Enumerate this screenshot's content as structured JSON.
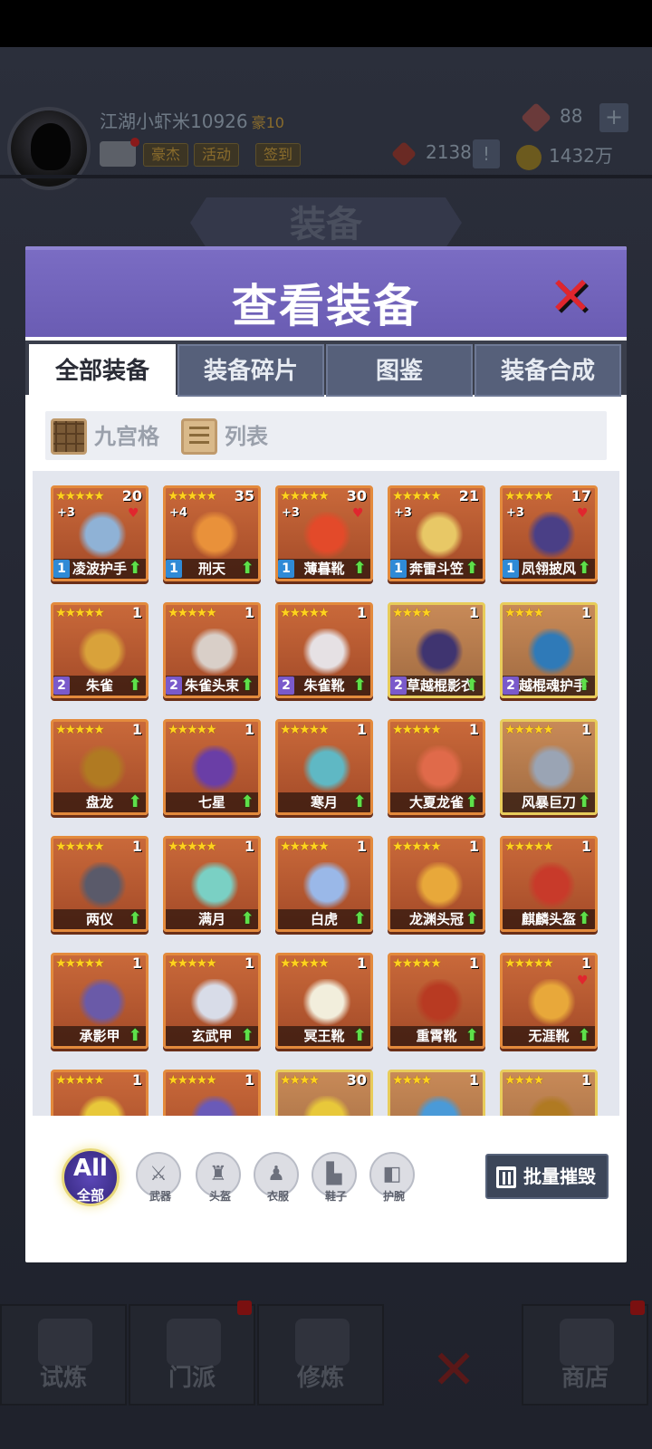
{
  "header": {
    "player_name": "江湖小虾米10926",
    "rank_badge": "豪10",
    "tags": [
      "豪杰",
      "活动",
      "签到"
    ],
    "gems": "88",
    "tokens": "2138",
    "coins": "1432万",
    "plus": "+",
    "excl": "!"
  },
  "background_title": "装备",
  "modal": {
    "title": "查看装备",
    "close": "✕",
    "tabs": [
      "全部装备",
      "装备碎片",
      "图鉴",
      "装备合成"
    ],
    "view_modes": [
      "九宫格",
      "列表"
    ],
    "items": [
      {
        "stars": "★★★★★",
        "count": "20",
        "level": "+3",
        "fav": true,
        "name": "凌波护手",
        "grade": "1",
        "grade_color": "#2f8ad6",
        "tier": 5,
        "art_color": "#8fb2d6"
      },
      {
        "stars": "★★★★★",
        "count": "35",
        "level": "+4",
        "fav": false,
        "name": "刑天",
        "grade": "1",
        "grade_color": "#2f8ad6",
        "tier": 5,
        "art_color": "#e9913a"
      },
      {
        "stars": "★★★★★",
        "count": "30",
        "level": "+3",
        "fav": true,
        "name": "薄暮靴",
        "grade": "1",
        "grade_color": "#2f8ad6",
        "tier": 5,
        "art_color": "#e34a2a"
      },
      {
        "stars": "★★★★★",
        "count": "21",
        "level": "+3",
        "fav": false,
        "name": "奔雷斗笠",
        "grade": "1",
        "grade_color": "#2f8ad6",
        "tier": 5,
        "art_color": "#e8c866"
      },
      {
        "stars": "★★★★★",
        "count": "17",
        "level": "+3",
        "fav": true,
        "name": "凤翎披风",
        "grade": "1",
        "grade_color": "#2f8ad6",
        "tier": 5,
        "art_color": "#4a3f86"
      },
      {
        "stars": "★★★★★",
        "count": "1",
        "level": "",
        "fav": false,
        "name": "朱雀",
        "grade": "2",
        "grade_color": "#7a5acb",
        "tier": 5,
        "art_color": "#d9a23a"
      },
      {
        "stars": "★★★★★",
        "count": "1",
        "level": "",
        "fav": false,
        "name": "朱雀头束",
        "grade": "2",
        "grade_color": "#7a5acb",
        "tier": 5,
        "art_color": "#d9cfc8"
      },
      {
        "stars": "★★★★★",
        "count": "1",
        "level": "",
        "fav": false,
        "name": "朱雀靴",
        "grade": "2",
        "grade_color": "#7a5acb",
        "tier": 5,
        "art_color": "#e6e1e4"
      },
      {
        "stars": "★★★★",
        "count": "1",
        "level": "",
        "fav": false,
        "name": "草越棍影衣",
        "grade": "2",
        "grade_color": "#7a5acb",
        "tier": 4,
        "art_color": "#3f3470"
      },
      {
        "stars": "★★★★",
        "count": "1",
        "level": "",
        "fav": false,
        "name": "越棍魂护手",
        "grade": "2",
        "grade_color": "#7a5acb",
        "tier": 4,
        "art_color": "#2f7ab8"
      },
      {
        "stars": "★★★★★",
        "count": "1",
        "level": "",
        "fav": false,
        "name": "盘龙",
        "grade": "",
        "grade_color": "",
        "tier": 5,
        "art_color": "#b07a22"
      },
      {
        "stars": "★★★★★",
        "count": "1",
        "level": "",
        "fav": false,
        "name": "七星",
        "grade": "",
        "grade_color": "",
        "tier": 5,
        "art_color": "#6a3ea6"
      },
      {
        "stars": "★★★★★",
        "count": "1",
        "level": "",
        "fav": false,
        "name": "寒月",
        "grade": "",
        "grade_color": "",
        "tier": 5,
        "art_color": "#5fb8c4"
      },
      {
        "stars": "★★★★★",
        "count": "1",
        "level": "",
        "fav": false,
        "name": "大夏龙雀",
        "grade": "",
        "grade_color": "",
        "tier": 5,
        "art_color": "#e06a4a"
      },
      {
        "stars": "★★★★★",
        "count": "1",
        "level": "",
        "fav": false,
        "name": "风暴巨刀",
        "grade": "",
        "grade_color": "",
        "tier": 4,
        "art_color": "#9aa4b4"
      },
      {
        "stars": "★★★★★",
        "count": "1",
        "level": "",
        "fav": false,
        "name": "两仪",
        "grade": "",
        "grade_color": "",
        "tier": 5,
        "art_color": "#5a5a6a"
      },
      {
        "stars": "★★★★★",
        "count": "1",
        "level": "",
        "fav": false,
        "name": "满月",
        "grade": "",
        "grade_color": "",
        "tier": 5,
        "art_color": "#7ad0c4"
      },
      {
        "stars": "★★★★★",
        "count": "1",
        "level": "",
        "fav": false,
        "name": "白虎",
        "grade": "",
        "grade_color": "",
        "tier": 5,
        "art_color": "#9ab8e8"
      },
      {
        "stars": "★★★★★",
        "count": "1",
        "level": "",
        "fav": false,
        "name": "龙渊头冠",
        "grade": "",
        "grade_color": "",
        "tier": 5,
        "art_color": "#e8a83a"
      },
      {
        "stars": "★★★★★",
        "count": "1",
        "level": "",
        "fav": false,
        "name": "麒麟头盔",
        "grade": "",
        "grade_color": "",
        "tier": 5,
        "art_color": "#c83a2a"
      },
      {
        "stars": "★★★★★",
        "count": "1",
        "level": "",
        "fav": false,
        "name": "承影甲",
        "grade": "",
        "grade_color": "",
        "tier": 5,
        "art_color": "#6a5aa8"
      },
      {
        "stars": "★★★★★",
        "count": "1",
        "level": "",
        "fav": false,
        "name": "玄武甲",
        "grade": "",
        "grade_color": "",
        "tier": 5,
        "art_color": "#d8dce8"
      },
      {
        "stars": "★★★★★",
        "count": "1",
        "level": "",
        "fav": false,
        "name": "冥王靴",
        "grade": "",
        "grade_color": "",
        "tier": 5,
        "art_color": "#f2eedc"
      },
      {
        "stars": "★★★★★",
        "count": "1",
        "level": "",
        "fav": false,
        "name": "重霄靴",
        "grade": "",
        "grade_color": "",
        "tier": 5,
        "art_color": "#b83a22"
      },
      {
        "stars": "★★★★★",
        "count": "1",
        "level": "",
        "fav": true,
        "name": "无涯靴",
        "grade": "",
        "grade_color": "",
        "tier": 5,
        "art_color": "#e8a83a"
      },
      {
        "stars": "★★★★★",
        "count": "1",
        "level": "",
        "fav": false,
        "name": "",
        "grade": "",
        "grade_color": "",
        "tier": 5,
        "art_color": "#e8c83a"
      },
      {
        "stars": "★★★★★",
        "count": "1",
        "level": "",
        "fav": false,
        "name": "",
        "grade": "",
        "grade_color": "",
        "tier": 5,
        "art_color": "#6a5ab8"
      },
      {
        "stars": "★★★★",
        "count": "30",
        "level": "",
        "fav": false,
        "name": "",
        "grade": "",
        "grade_color": "",
        "tier": 4,
        "art_color": "#e8c83a"
      },
      {
        "stars": "★★★★",
        "count": "1",
        "level": "",
        "fav": false,
        "name": "",
        "grade": "",
        "grade_color": "",
        "tier": 4,
        "art_color": "#4a9ad8"
      },
      {
        "stars": "★★★★",
        "count": "1",
        "level": "",
        "fav": false,
        "name": "",
        "grade": "",
        "grade_color": "",
        "tier": 4,
        "art_color": "#b07a22"
      }
    ],
    "filters": {
      "all_big": "All",
      "all_small": "全部",
      "categories": [
        {
          "label": "武器",
          "glyph": "⚔",
          "icon": "sword-icon"
        },
        {
          "label": "头盔",
          "glyph": "♜",
          "icon": "helmet-icon"
        },
        {
          "label": "衣服",
          "glyph": "♟",
          "icon": "clothes-icon"
        },
        {
          "label": "鞋子",
          "glyph": "▙",
          "icon": "shoe-icon"
        },
        {
          "label": "护腕",
          "glyph": "◧",
          "icon": "bracer-icon"
        }
      ]
    },
    "bulk_destroy": "批量摧毁"
  },
  "bottom_nav": [
    "试炼",
    "门派",
    "修炼",
    "",
    "商店"
  ]
}
